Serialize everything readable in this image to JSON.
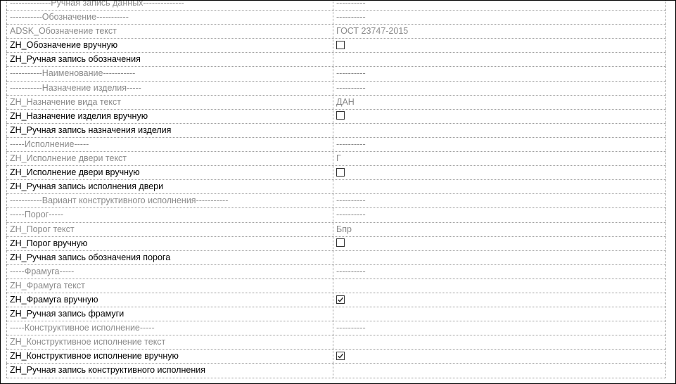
{
  "rows": [
    {
      "name": "--------------Ручная запись данных--------------",
      "value": "----------",
      "style": "gray",
      "kind": "text"
    },
    {
      "name": "-----------Обозначение-----------",
      "value": "----------",
      "style": "gray",
      "kind": "text"
    },
    {
      "name": "ADSK_Обозначение текст",
      "value": "ГОСТ 23747-2015",
      "style": "gray",
      "kind": "text"
    },
    {
      "name": "ZH_Обозначение вручную",
      "value": "",
      "style": "black",
      "kind": "checkbox",
      "checked": false
    },
    {
      "name": "ZH_Ручная запись обозначения",
      "value": "",
      "style": "black",
      "kind": "text"
    },
    {
      "name": "-----------Наименование-----------",
      "value": "----------",
      "style": "gray",
      "kind": "text"
    },
    {
      "name": "-----------Назначение изделия-----",
      "value": "----------",
      "style": "gray",
      "kind": "text"
    },
    {
      "name": "ZH_Назначение вида текст",
      "value": "ДАН",
      "style": "gray",
      "kind": "text"
    },
    {
      "name": "ZH_Назначение изделия вручную",
      "value": "",
      "style": "black",
      "kind": "checkbox",
      "checked": false
    },
    {
      "name": "ZH_Ручная запись назначения изделия",
      "value": "",
      "style": "black",
      "kind": "text"
    },
    {
      "name": "-----Исполнение-----",
      "value": "----------",
      "style": "gray",
      "kind": "text"
    },
    {
      "name": "ZH_Исполнение двери текст",
      "value": "Г",
      "style": "gray",
      "kind": "text"
    },
    {
      "name": "ZH_Исполнение двери вручную",
      "value": "",
      "style": "black",
      "kind": "checkbox",
      "checked": false
    },
    {
      "name": "ZH_Ручная запись исполнения двери",
      "value": "",
      "style": "black",
      "kind": "text"
    },
    {
      "name": "-----------Вариант конструктивного исполнения-----------",
      "value": "----------",
      "style": "gray",
      "kind": "text"
    },
    {
      "name": "-----Порог-----",
      "value": "----------",
      "style": "gray",
      "kind": "text"
    },
    {
      "name": "ZH_Порог текст",
      "value": "Бпр",
      "style": "gray",
      "kind": "text"
    },
    {
      "name": "ZH_Порог вручную",
      "value": "",
      "style": "black",
      "kind": "checkbox",
      "checked": false
    },
    {
      "name": "ZH_Ручная запись обозначения порога",
      "value": "",
      "style": "black",
      "kind": "text"
    },
    {
      "name": "-----Фрамуга-----",
      "value": "----------",
      "style": "gray",
      "kind": "text"
    },
    {
      "name": "ZH_Фрамуга текст",
      "value": "",
      "style": "gray",
      "kind": "text"
    },
    {
      "name": "ZH_Фрамуга вручную",
      "value": "",
      "style": "black",
      "kind": "checkbox",
      "checked": true
    },
    {
      "name": "ZH_Ручная запись фрамуги",
      "value": "",
      "style": "black",
      "kind": "text"
    },
    {
      "name": "-----Конструктивное исполнение-----",
      "value": "----------",
      "style": "gray",
      "kind": "text"
    },
    {
      "name": "ZH_Конструктивное исполнение текст",
      "value": "",
      "style": "gray",
      "kind": "text"
    },
    {
      "name": "ZH_Конструктивное исполнение вручную",
      "value": "",
      "style": "black",
      "kind": "checkbox",
      "checked": true
    },
    {
      "name": "ZH_Ручная запись конструктивного исполнения",
      "value": "",
      "style": "black",
      "kind": "text"
    }
  ],
  "colors": {
    "readonly_text": "#8a8a8a",
    "editable_text": "#000000",
    "grid_line": "#9a9a9a",
    "checkmark": "#222222"
  }
}
